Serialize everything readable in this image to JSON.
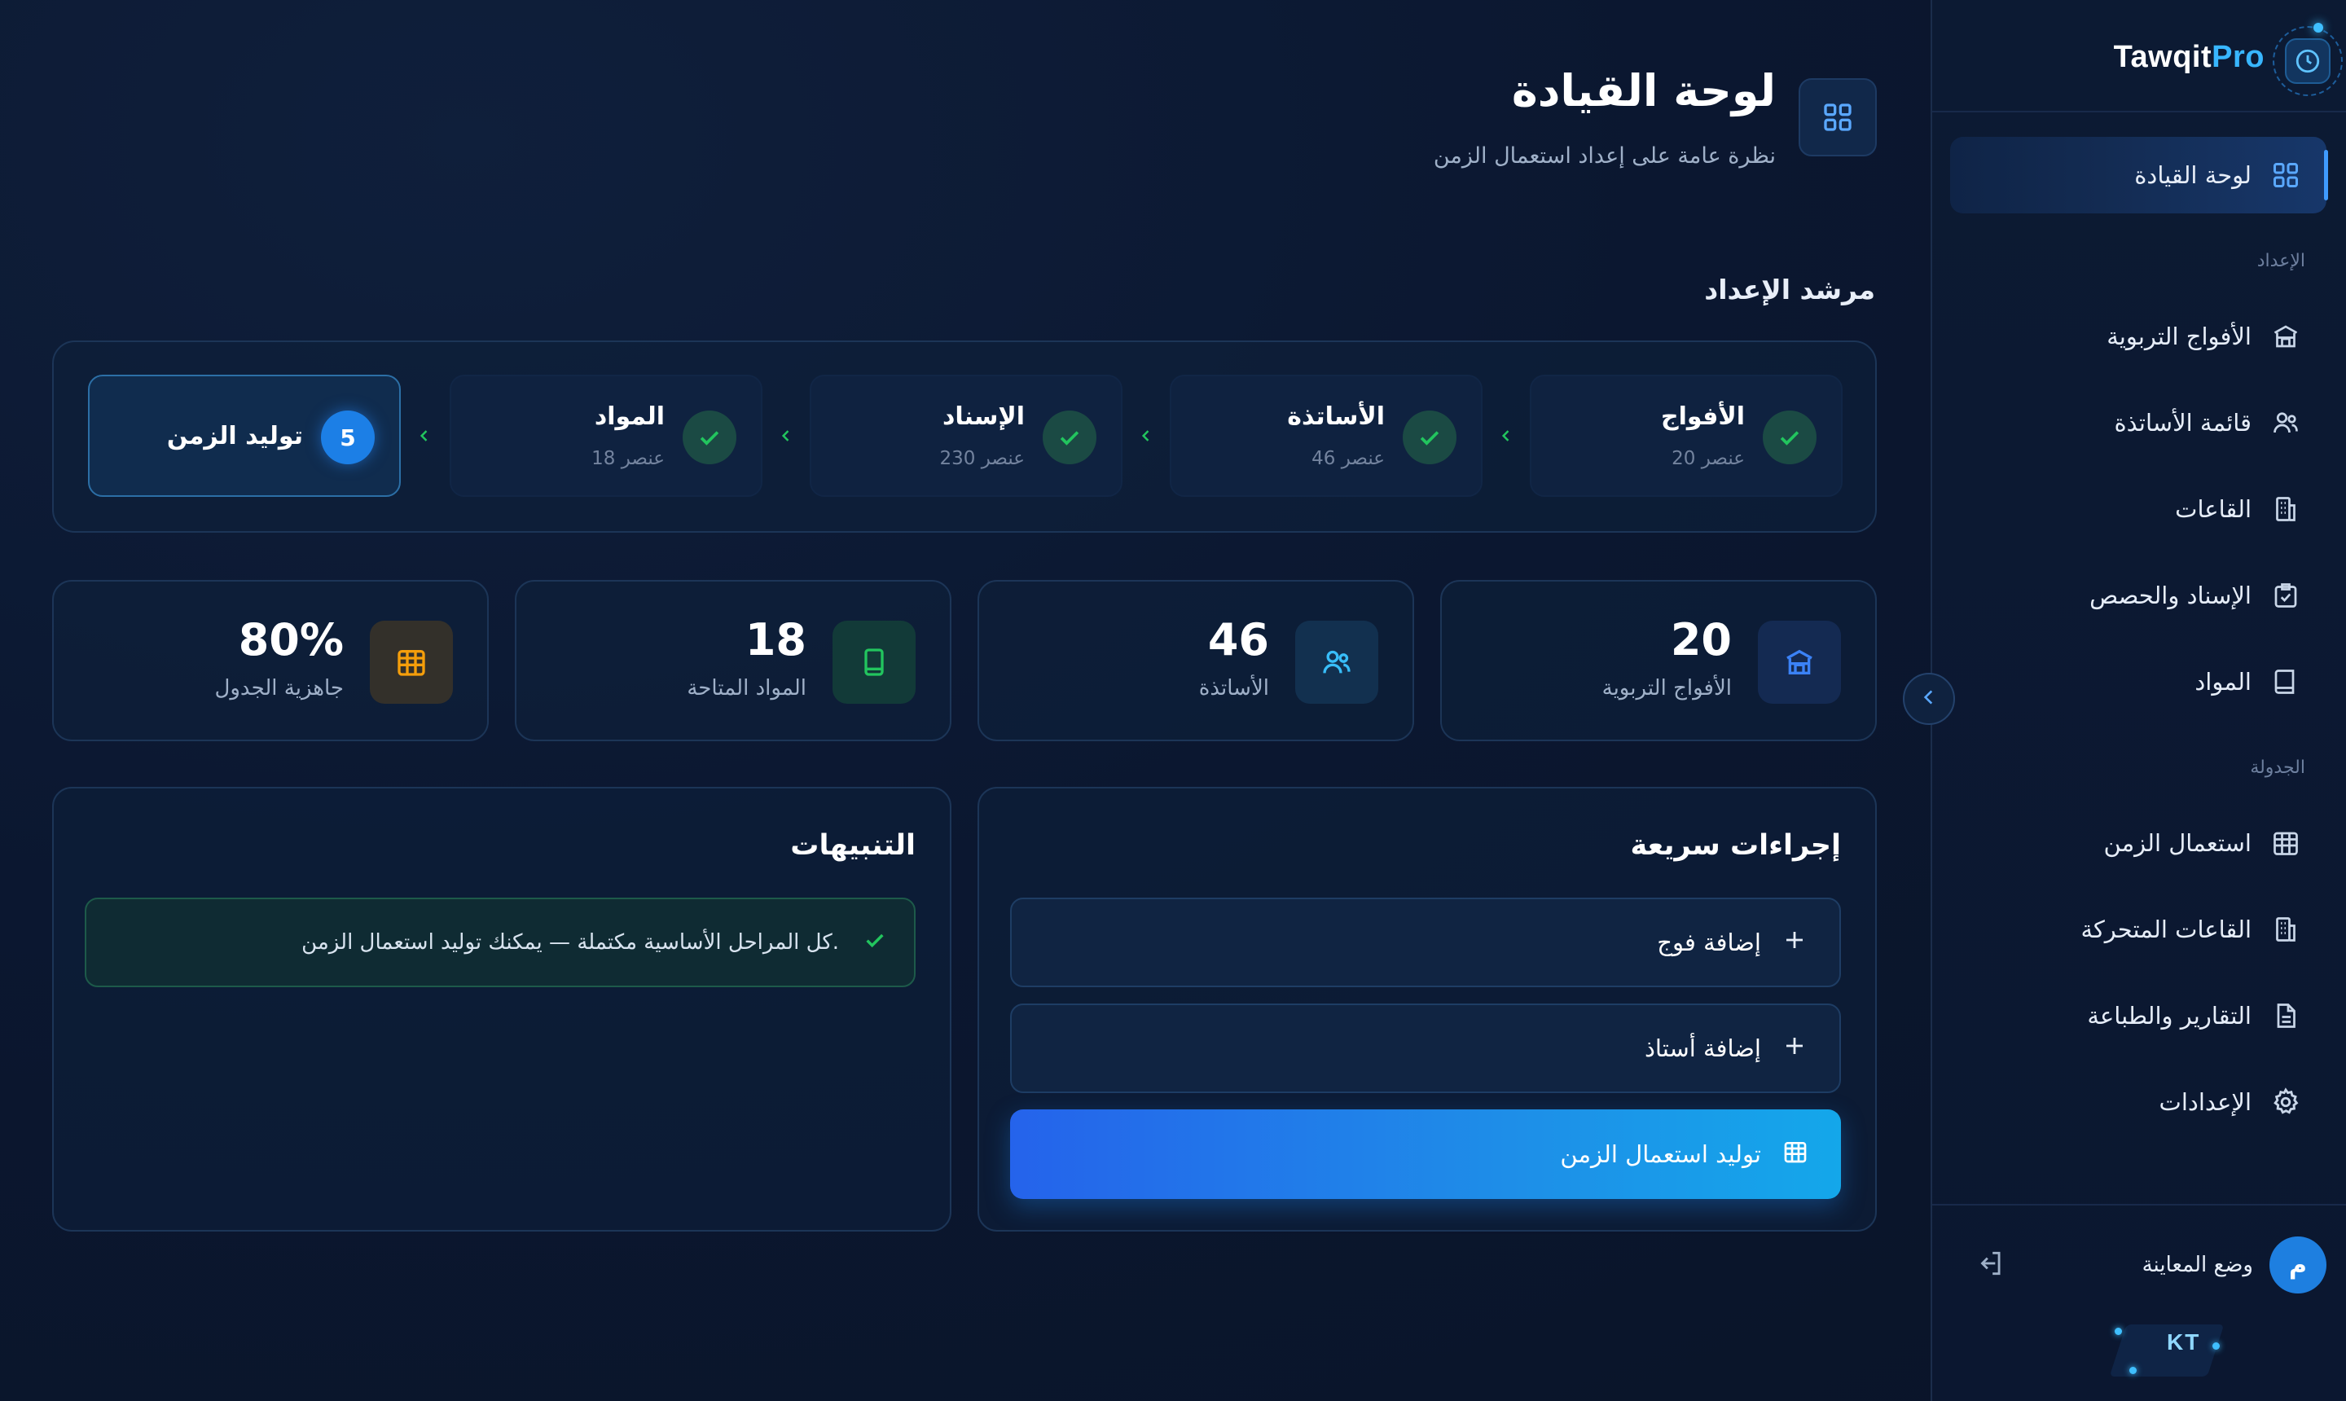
{
  "brand": {
    "name_main": "Tawqit",
    "name_accent": "Pro"
  },
  "sidebar": {
    "items_top": [
      {
        "label": "لوحة القيادة",
        "icon": "dashboard-icon",
        "active": true
      }
    ],
    "section_setup": "الإعداد",
    "items_setup": [
      {
        "label": "الأفواج التربوية",
        "icon": "school-building-icon"
      },
      {
        "label": "قائمة الأساتذة",
        "icon": "users-icon"
      },
      {
        "label": "القاعات",
        "icon": "building-icon"
      },
      {
        "label": "الإسناد والحصص",
        "icon": "clipboard-check-icon"
      },
      {
        "label": "المواد",
        "icon": "book-icon"
      }
    ],
    "section_schedule": "الجدولة",
    "items_schedule": [
      {
        "label": "استعمال الزمن",
        "icon": "grid-calendar-icon"
      },
      {
        "label": "القاعات المتحركة",
        "icon": "building-icon"
      },
      {
        "label": "التقارير والطباعة",
        "icon": "document-icon"
      },
      {
        "label": "الإعدادات",
        "icon": "gear-icon"
      }
    ],
    "user": {
      "avatar_letter": "م",
      "label": "وضع المعاينة"
    },
    "badge": "KT"
  },
  "header": {
    "title": "لوحة القيادة",
    "subtitle": "نظرة عامة على إعداد استعمال الزمن"
  },
  "wizard": {
    "title": "مرشد الإعداد",
    "steps": [
      {
        "name": "الأفواج",
        "count": "20 عنصر",
        "done": true
      },
      {
        "name": "الأساتذة",
        "count": "46 عنصر",
        "done": true
      },
      {
        "name": "الإسناد",
        "count": "230 عنصر",
        "done": true
      },
      {
        "name": "المواد",
        "count": "18 عنصر",
        "done": true
      },
      {
        "name": "توليد الزمن",
        "number": "5",
        "current": true
      }
    ]
  },
  "stats": [
    {
      "value": "20",
      "label": "الأفواج التربوية",
      "icon": "school-building-icon",
      "color": "#3b82f6",
      "bg": "#142a52"
    },
    {
      "value": "46",
      "label": "الأساتذة",
      "icon": "users-icon",
      "color": "#38bdf8",
      "bg": "#12304f"
    },
    {
      "value": "18",
      "label": "المواد المتاحة",
      "icon": "book-icon",
      "color": "#22c55e",
      "bg": "#123a38"
    },
    {
      "value": "80%",
      "label": "جاهزية الجدول",
      "icon": "grid-calendar-icon",
      "color": "#f59e0b",
      "bg": "#33302a"
    }
  ],
  "quick_actions": {
    "title": "إجراءات سريعة",
    "items": [
      {
        "label": "إضافة فوج",
        "icon": "plus-icon"
      },
      {
        "label": "إضافة أستاذ",
        "icon": "plus-icon"
      },
      {
        "label": "توليد استعمال الزمن",
        "icon": "grid-calendar-icon",
        "primary": true
      }
    ]
  },
  "alerts": {
    "title": "التنبيهات",
    "items": [
      {
        "text": "كل المراحل الأساسية مكتملة — يمكنك توليد استعمال الزمن.",
        "icon": "check-icon"
      }
    ]
  },
  "colors": {
    "accent": "#38b6ff",
    "success": "#22c55e",
    "background": "#0b1730"
  }
}
